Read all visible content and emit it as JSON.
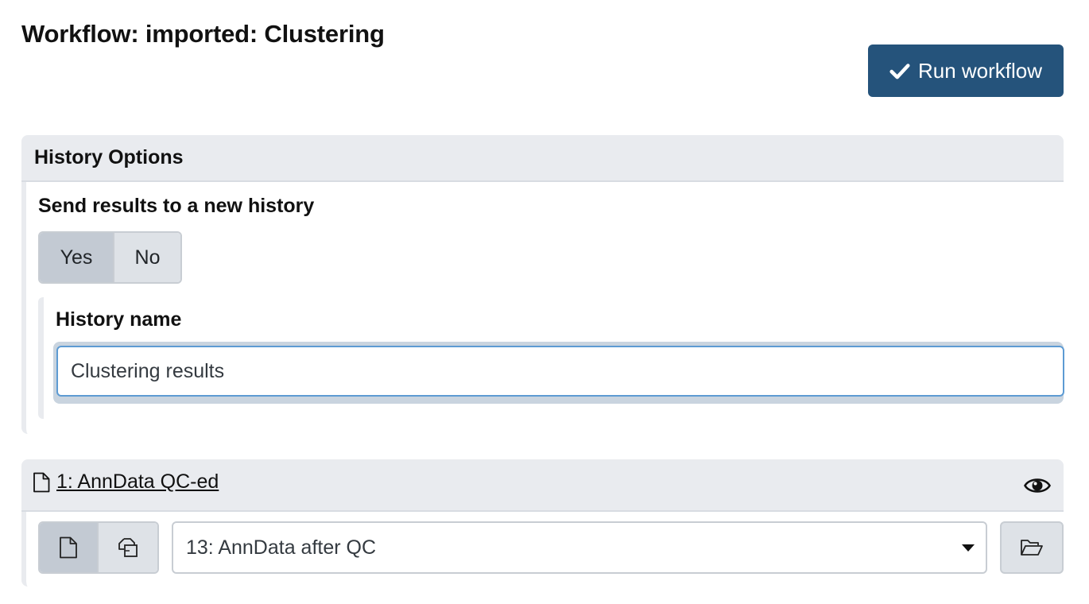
{
  "workflow": {
    "title": "Workflow: imported: Clustering",
    "run_button_label": "Run workflow",
    "run_icon": "check-icon"
  },
  "history_options": {
    "header": "History Options",
    "send_results_label": "Send results to a new history",
    "toggle": {
      "yes_label": "Yes",
      "no_label": "No",
      "selected": "Yes"
    },
    "history_name_label": "History name",
    "history_name_value": "Clustering results"
  },
  "input_step": {
    "title": "1: AnnData QC-ed",
    "title_icon": "file-icon",
    "visibility_icon": "eye-icon",
    "mode_icons": [
      "file-icon",
      "files-icon"
    ],
    "selected_dataset": "13: AnnData after QC",
    "browse_icon": "folder-open-icon"
  },
  "colors": {
    "primary": "#25537b",
    "header_bg": "#e9ebef",
    "focus_border": "#5d9bd3"
  }
}
